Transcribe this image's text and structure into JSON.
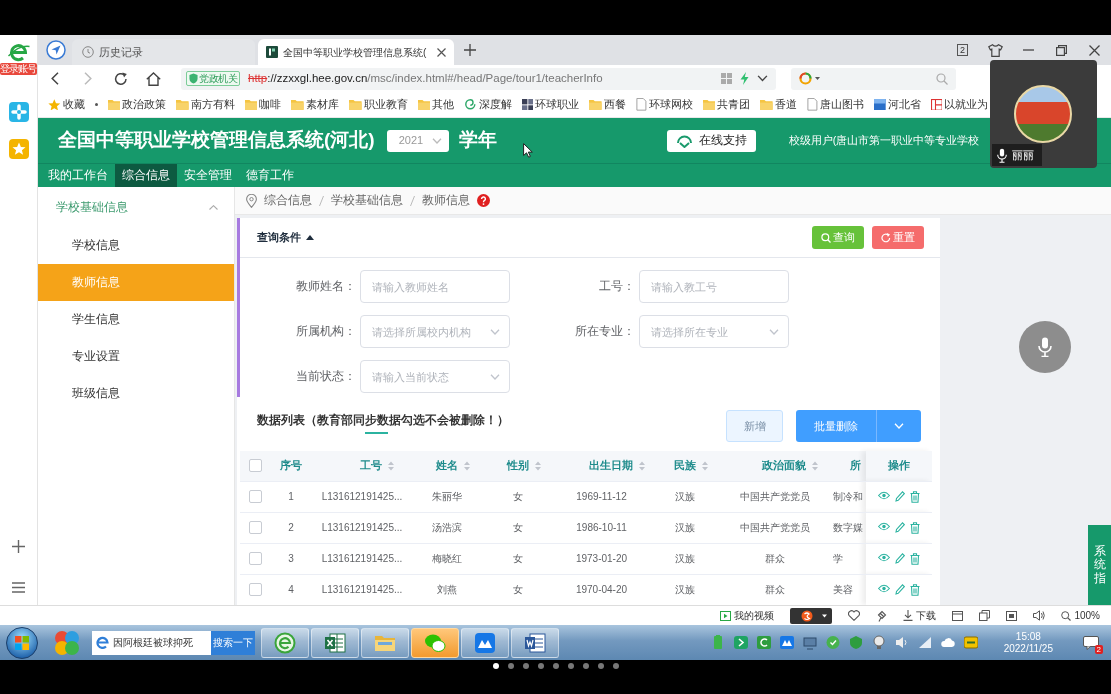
{
  "browser": {
    "login_label": "登录账号",
    "tabs": [
      {
        "label": "历史记录",
        "selected": false
      },
      {
        "label": "全国中等职业学校管理信息系统(",
        "selected": true
      }
    ],
    "tab_count": "2",
    "address": {
      "badge": "党政机关",
      "scheme": "http",
      "host": "://zzxxgl.hee.gov.cn",
      "path": "/msc/index.html#/head/Page/tour1/teacherInfo"
    },
    "bookmarks": [
      {
        "label": "收藏",
        "kind": "star"
      },
      {
        "label": "政治政策",
        "kind": "folder"
      },
      {
        "label": "南方有料",
        "kind": "folder"
      },
      {
        "label": "咖啡",
        "kind": "folder"
      },
      {
        "label": "素材库",
        "kind": "folder"
      },
      {
        "label": "职业教育",
        "kind": "folder"
      },
      {
        "label": "其他",
        "kind": "folder"
      },
      {
        "label": "深度解",
        "kind": "swirl"
      },
      {
        "label": "环球职业",
        "kind": "grid"
      },
      {
        "label": "西餐",
        "kind": "folder"
      },
      {
        "label": "环球网校",
        "kind": "page"
      },
      {
        "label": "共青团",
        "kind": "folder"
      },
      {
        "label": "香道",
        "kind": "folder"
      },
      {
        "label": "唐山图书",
        "kind": "page"
      },
      {
        "label": "河北省",
        "kind": "cube"
      },
      {
        "label": "以就业为",
        "kind": "panel"
      }
    ]
  },
  "site": {
    "title": "全国中等职业学校管理信息系统(河北)",
    "year": "2021",
    "year_suffix": "学年",
    "support_button": "在线支持",
    "user": "校级用户(唐山市第一职业中等专业学校",
    "nav": [
      {
        "label": "我的工作台",
        "selected": false
      },
      {
        "label": "综合信息",
        "selected": true
      },
      {
        "label": "安全管理",
        "selected": false
      },
      {
        "label": "德育工作",
        "selected": false
      }
    ],
    "sidebar": {
      "group": "学校基础信息",
      "expanded": true,
      "items": [
        {
          "label": "学校信息",
          "selected": false
        },
        {
          "label": "教师信息",
          "selected": true
        },
        {
          "label": "学生信息",
          "selected": false
        },
        {
          "label": "专业设置",
          "selected": false
        },
        {
          "label": "班级信息",
          "selected": false
        }
      ]
    },
    "breadcrumb": [
      "综合信息",
      "学校基础信息",
      "教师信息"
    ],
    "query": {
      "title": "查询条件",
      "expanded": true,
      "buttons": [
        {
          "label": "查询",
          "kind": "search"
        },
        {
          "label": "重置",
          "kind": "reset"
        }
      ],
      "fields": [
        {
          "label": "教师姓名：",
          "placeholder": "请输入教师姓名",
          "kind": "input"
        },
        {
          "label": "工号：",
          "placeholder": "请输入教工号",
          "kind": "input"
        },
        {
          "label": "所属机构：",
          "placeholder": "请选择所属校内机构",
          "kind": "select"
        },
        {
          "label": "所在专业：",
          "placeholder": "请选择所在专业",
          "kind": "select"
        },
        {
          "label": "当前状态：",
          "placeholder": "请输入当前状态",
          "kind": "select"
        }
      ]
    },
    "list": {
      "title": "数据列表（教育部同步数据勾选不会被删除！）",
      "buttons": [
        {
          "label": "新增",
          "kind": "plain"
        },
        {
          "label": "批量删除",
          "kind": "split"
        }
      ]
    },
    "table": {
      "all_checked": false,
      "columns": [
        {
          "label": "序号",
          "sortable": false
        },
        {
          "label": "工号",
          "sortable": true
        },
        {
          "label": "姓名",
          "sortable": true
        },
        {
          "label": "性别",
          "sortable": true
        },
        {
          "label": "出生日期",
          "sortable": true
        },
        {
          "label": "民族",
          "sortable": true
        },
        {
          "label": "政治面貌",
          "sortable": true
        },
        {
          "label": "所",
          "sortable": false
        },
        {
          "label": "操作",
          "sortable": false
        }
      ],
      "rows": [
        {
          "checked": false,
          "cells": [
            "1",
            "L131612191425...",
            "朱丽华",
            "女",
            "1969-11-12",
            "汉族",
            "中国共产党党员",
            "制冷和"
          ]
        },
        {
          "checked": false,
          "cells": [
            "2",
            "L131612191425...",
            "汤浩滨",
            "女",
            "1986-10-11",
            "汉族",
            "中国共产党党员",
            "数字媒"
          ]
        },
        {
          "checked": false,
          "cells": [
            "3",
            "L131612191425...",
            "梅晓红",
            "女",
            "1973-01-20",
            "汉族",
            "群众",
            "学"
          ]
        },
        {
          "checked": false,
          "cells": [
            "4",
            "L131612191425...",
            "刘燕",
            "女",
            "1970-04-20",
            "汉族",
            "群众",
            "美容"
          ]
        }
      ]
    },
    "help_tab": "系统指"
  },
  "video_call": {
    "name": "丽丽"
  },
  "status_bar": {
    "video": "我的视频",
    "download": "下载",
    "zoom": "100%"
  },
  "taskbar": {
    "search_value": "因阿根廷被球抑死",
    "search_button": "搜索一下",
    "apps": [
      {
        "kind": "browser",
        "highlighted": false
      },
      {
        "kind": "spreadsheet",
        "highlighted": false
      },
      {
        "kind": "folder",
        "highlighted": false
      },
      {
        "kind": "chat",
        "highlighted": true
      },
      {
        "kind": "cloud",
        "highlighted": false
      },
      {
        "kind": "document",
        "highlighted": false
      }
    ],
    "time": "15:08",
    "date": "2022/11/25",
    "notifications": "2"
  },
  "pager": {
    "dots": [
      {
        "selected": true
      },
      {
        "selected": false
      },
      {
        "selected": false
      },
      {
        "selected": false
      },
      {
        "selected": false
      },
      {
        "selected": false
      },
      {
        "selected": false
      },
      {
        "selected": false
      },
      {
        "selected": false
      }
    ]
  }
}
